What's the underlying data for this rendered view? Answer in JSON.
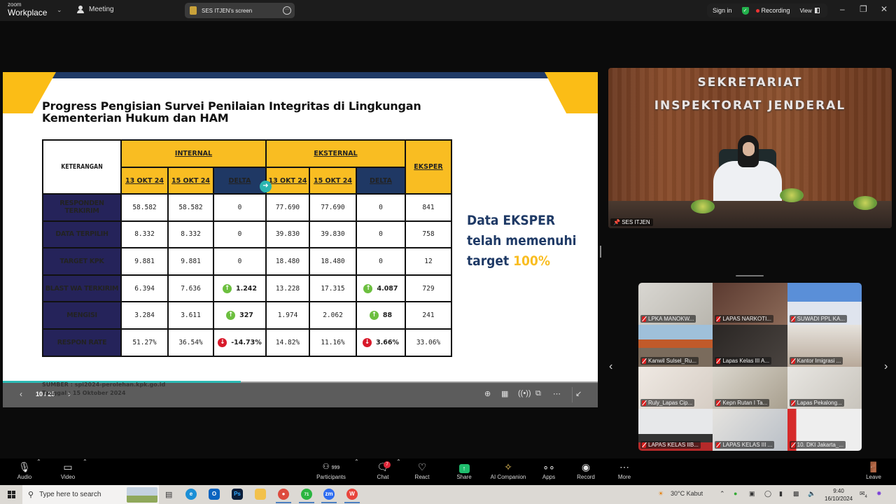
{
  "titlebar": {
    "brand_top": "zoom",
    "brand_bottom": "Workplace",
    "meeting_label": "Meeting",
    "screen_share_label": "SES ITJEN's screen",
    "sign_in": "Sign in",
    "recording": "Recording",
    "view": "View"
  },
  "slide": {
    "title_line1": "Progress Pengisian Survei Penilaian Integritas di Lingkungan",
    "title_line2": "Kementerian Hukum dan HAM",
    "table": {
      "keterangan": "KETERANGAN",
      "group_internal": "INTERNAL",
      "group_eksternal": "EKSTERNAL",
      "eksper": "EKSPER",
      "sub_headers": [
        "13 OKT 24",
        "15 OKT 24",
        "DELTA",
        "13 OKT 24",
        "15 OKT 24",
        "DELTA"
      ],
      "rows": [
        {
          "label": "RESPONDEN TERKIRIM",
          "int13": "58.582",
          "int15": "58.582",
          "int_delta": "0",
          "int_dir": "",
          "ext13": "77.690",
          "ext15": "77.690",
          "ext_delta": "0",
          "ext_dir": "",
          "eksper": "841"
        },
        {
          "label": "DATA TERPILIH",
          "int13": "8.332",
          "int15": "8.332",
          "int_delta": "0",
          "int_dir": "",
          "ext13": "39.830",
          "ext15": "39.830",
          "ext_delta": "0",
          "ext_dir": "",
          "eksper": "758"
        },
        {
          "label": "TARGET KPK",
          "int13": "9.881",
          "int15": "9.881",
          "int_delta": "0",
          "int_dir": "",
          "ext13": "18.480",
          "ext15": "18.480",
          "ext_delta": "0",
          "ext_dir": "",
          "eksper": "12"
        },
        {
          "label": "BLAST WA TERKIRIM",
          "int13": "6.394",
          "int15": "7.636",
          "int_delta": "1.242",
          "int_dir": "up",
          "ext13": "13.228",
          "ext15": "17.315",
          "ext_delta": "4.087",
          "ext_dir": "up",
          "eksper": "729"
        },
        {
          "label": "MENGISI",
          "int13": "3.284",
          "int15": "3.611",
          "int_delta": "327",
          "int_dir": "up",
          "ext13": "1.974",
          "ext15": "2.062",
          "ext_delta": "88",
          "ext_dir": "up",
          "eksper": "241"
        },
        {
          "label": "RESPON RATE",
          "int13": "51.27%",
          "int15": "36.54%",
          "int_delta": "-14.73%",
          "int_dir": "down",
          "ext13": "14.82%",
          "ext15": "11.16%",
          "ext_delta": "3.66%",
          "ext_dir": "down",
          "eksper": "33.06%"
        }
      ]
    },
    "callout_line1": "Data EKSPER",
    "callout_line2": "telah memenuhi",
    "callout_line3_prefix": "target ",
    "callout_highlight": "100%",
    "source_line1": "SUMBER : spi2024-perolehan.kpk.go.id",
    "source_line2": "Tanggal : 15 Oktober 2024",
    "colors": {
      "navy": "#1f3a66",
      "yellow": "#f9bd22",
      "row_label_bg": "#25235a",
      "up": "#6cbf3f",
      "down": "#d8192a"
    }
  },
  "slide_controls": {
    "page_indicator": "10 / 25",
    "progress_fraction": 0.4
  },
  "speaker": {
    "wall_line1": "SEKRETARIAT",
    "wall_line2": "INSPEKTORAT JENDERAL",
    "name": "SES ITJEN"
  },
  "gallery": {
    "tiles": [
      {
        "name": "LPKA MANOKW..."
      },
      {
        "name": "LAPAS NARKOTI..."
      },
      {
        "name": "SUWADI PPL KA..."
      },
      {
        "name": "Kanwil Sulsel_Ru..."
      },
      {
        "name": "Lapas Kelas III A..."
      },
      {
        "name": "Kantor Imigrasi ..."
      },
      {
        "name": "Ruly_Lapas Cip..."
      },
      {
        "name": "Kepn Rutan I Ta..."
      },
      {
        "name": "Lapas Pekalong..."
      },
      {
        "name": "LAPAS KELAS IIB..."
      },
      {
        "name": "LAPAS KELAS III ..."
      },
      {
        "name": "10. DKI Jakarta_..."
      }
    ]
  },
  "toolbar": {
    "audio": "Audio",
    "video": "Video",
    "participants": "Participants",
    "participants_count": "999",
    "chat": "Chat",
    "chat_badge": "7",
    "react": "React",
    "share": "Share",
    "ai_companion": "AI Companion",
    "apps": "Apps",
    "record": "Record",
    "more": "More",
    "leave": "Leave"
  },
  "taskbar": {
    "search_placeholder": "Type here to search",
    "whatsapp_badge": "71",
    "weather": "30°C  Kabut",
    "time": "9:40",
    "date": "16/10/2024",
    "notifications": "4"
  }
}
